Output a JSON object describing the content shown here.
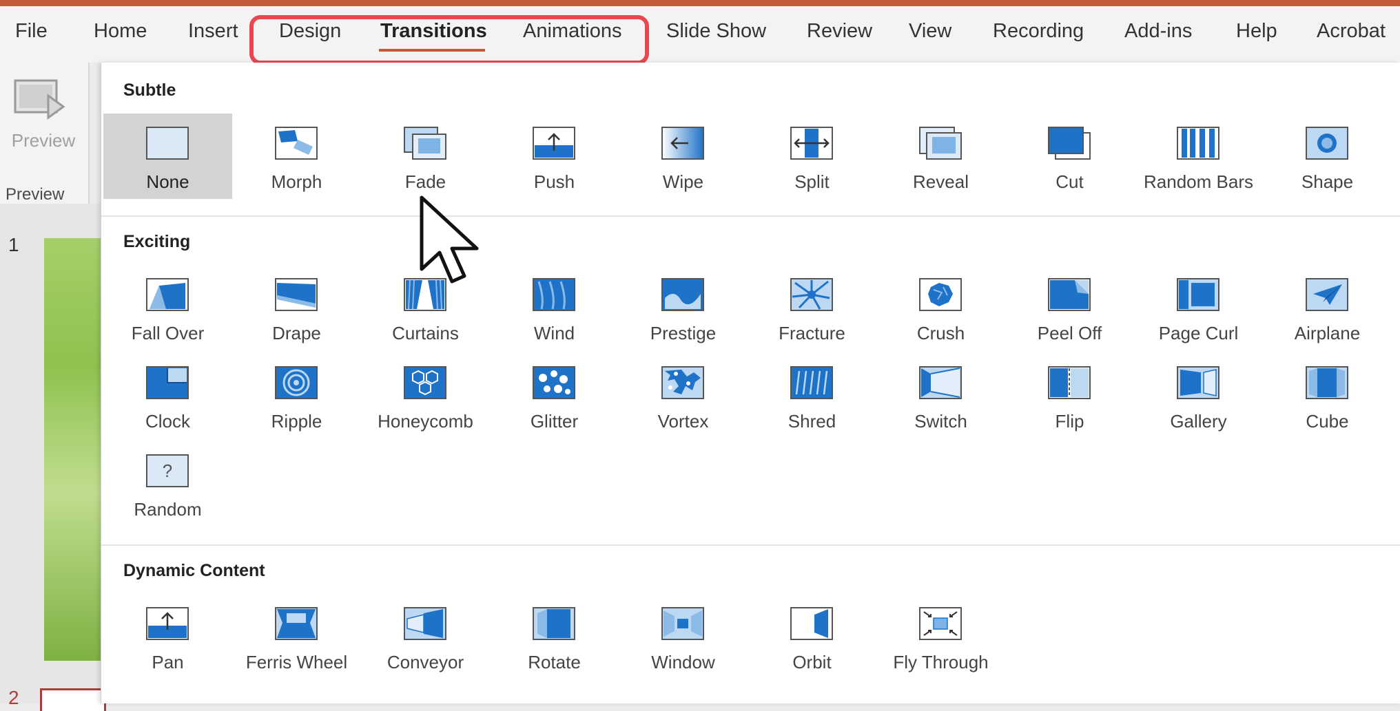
{
  "tabs": [
    "File",
    "Home",
    "Insert",
    "Design",
    "Transitions",
    "Animations",
    "Slide Show",
    "Review",
    "View",
    "Recording",
    "Add-ins",
    "Help",
    "Acrobat"
  ],
  "active_tab": "Transitions",
  "preview": {
    "button_label": "Preview",
    "group_label": "Preview"
  },
  "slide_numbers": [
    "1",
    "2"
  ],
  "gallery": {
    "sections": [
      {
        "title": "Subtle",
        "items": [
          {
            "label": "None",
            "icon": "none-icon",
            "selected": true
          },
          {
            "label": "Morph",
            "icon": "morph-icon"
          },
          {
            "label": "Fade",
            "icon": "fade-icon"
          },
          {
            "label": "Push",
            "icon": "push-icon"
          },
          {
            "label": "Wipe",
            "icon": "wipe-icon"
          },
          {
            "label": "Split",
            "icon": "split-icon"
          },
          {
            "label": "Reveal",
            "icon": "reveal-icon"
          },
          {
            "label": "Cut",
            "icon": "cut-icon"
          },
          {
            "label": "Random Bars",
            "icon": "random-bars-icon"
          },
          {
            "label": "Shape",
            "icon": "shape-icon"
          }
        ]
      },
      {
        "title": "Exciting",
        "items": [
          {
            "label": "Fall Over",
            "icon": "fall-over-icon"
          },
          {
            "label": "Drape",
            "icon": "drape-icon"
          },
          {
            "label": "Curtains",
            "icon": "curtains-icon"
          },
          {
            "label": "Wind",
            "icon": "wind-icon"
          },
          {
            "label": "Prestige",
            "icon": "prestige-icon"
          },
          {
            "label": "Fracture",
            "icon": "fracture-icon"
          },
          {
            "label": "Crush",
            "icon": "crush-icon"
          },
          {
            "label": "Peel Off",
            "icon": "peel-off-icon"
          },
          {
            "label": "Page Curl",
            "icon": "page-curl-icon"
          },
          {
            "label": "Airplane",
            "icon": "airplane-icon"
          },
          {
            "label": "Clock",
            "icon": "clock-icon"
          },
          {
            "label": "Ripple",
            "icon": "ripple-icon"
          },
          {
            "label": "Honeycomb",
            "icon": "honeycomb-icon"
          },
          {
            "label": "Glitter",
            "icon": "glitter-icon"
          },
          {
            "label": "Vortex",
            "icon": "vortex-icon"
          },
          {
            "label": "Shred",
            "icon": "shred-icon"
          },
          {
            "label": "Switch",
            "icon": "switch-icon"
          },
          {
            "label": "Flip",
            "icon": "flip-icon"
          },
          {
            "label": "Gallery",
            "icon": "gallery-icon"
          },
          {
            "label": "Cube",
            "icon": "cube-icon"
          },
          {
            "label": "Random",
            "icon": "random-icon"
          }
        ]
      },
      {
        "title": "Dynamic Content",
        "items": [
          {
            "label": "Pan",
            "icon": "pan-icon"
          },
          {
            "label": "Ferris Wheel",
            "icon": "ferris-wheel-icon"
          },
          {
            "label": "Conveyor",
            "icon": "conveyor-icon"
          },
          {
            "label": "Rotate",
            "icon": "rotate-icon"
          },
          {
            "label": "Window",
            "icon": "window-icon"
          },
          {
            "label": "Orbit",
            "icon": "orbit-icon"
          },
          {
            "label": "Fly Through",
            "icon": "fly-through-icon"
          }
        ]
      }
    ]
  },
  "colors": {
    "accent": "#c55a3a",
    "highlight_box": "#e8474f",
    "icon_blue": "#1e73c8",
    "icon_light": "#bcd8f3"
  }
}
